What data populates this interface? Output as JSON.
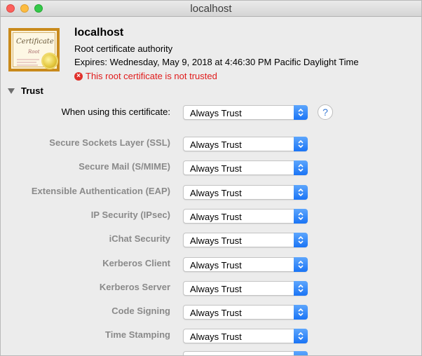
{
  "window": {
    "title": "localhost"
  },
  "certificate": {
    "icon_text": "Certificate",
    "icon_subtext": "Root",
    "name": "localhost",
    "kind": "Root certificate authority",
    "expires": "Expires: Wednesday, May 9, 2018 at 4:46:30 PM Pacific Daylight Time",
    "warning": "This root certificate is not trusted"
  },
  "trust": {
    "section_title": "Trust",
    "primary": {
      "label": "When using this certificate:",
      "value": "Always Trust"
    },
    "help_label": "?",
    "rows": [
      {
        "label": "Secure Sockets Layer (SSL)",
        "value": "Always Trust"
      },
      {
        "label": "Secure Mail (S/MIME)",
        "value": "Always Trust"
      },
      {
        "label": "Extensible Authentication (EAP)",
        "value": "Always Trust"
      },
      {
        "label": "IP Security (IPsec)",
        "value": "Always Trust"
      },
      {
        "label": "iChat Security",
        "value": "Always Trust"
      },
      {
        "label": "Kerberos Client",
        "value": "Always Trust"
      },
      {
        "label": "Kerberos Server",
        "value": "Always Trust"
      },
      {
        "label": "Code Signing",
        "value": "Always Trust"
      },
      {
        "label": "Time Stamping",
        "value": "Always Trust"
      }
    ]
  },
  "colors": {
    "accent": "#1a74f5",
    "warning": "#e01b1b",
    "muted_label": "#8a8a8a"
  }
}
